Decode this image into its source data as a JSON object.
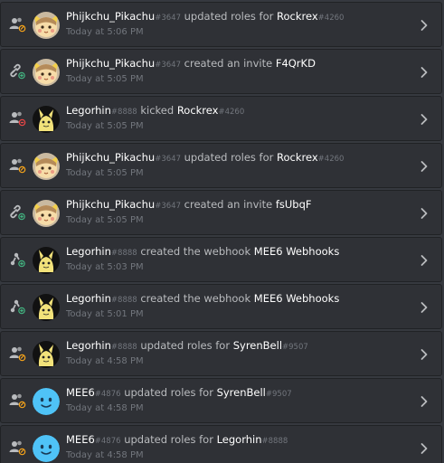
{
  "colors": {
    "background": "#36393f",
    "entry_bg": "#2f3136",
    "accent_update": "#faa61a",
    "accent_create": "#43b581",
    "accent_delete": "#f04747"
  },
  "entries": [
    {
      "action": "update",
      "avatar": "pikachu",
      "user": "Phijkchu_Pikachu",
      "user_disc": "#3647",
      "verb": "updated roles for",
      "target": "Rockrex",
      "target_disc": "#4260",
      "time": "Today at 5:06 PM"
    },
    {
      "action": "invite",
      "avatar": "pikachu",
      "user": "Phijkchu_Pikachu",
      "user_disc": "#3647",
      "verb": "created an invite",
      "target": "F4QrKD",
      "target_disc": "",
      "time": "Today at 5:05 PM"
    },
    {
      "action": "kick",
      "avatar": "mimikyu",
      "user": "Legorhin",
      "user_disc": "#8888",
      "verb": "kicked",
      "target": "Rockrex",
      "target_disc": "#4260",
      "time": "Today at 5:05 PM"
    },
    {
      "action": "update",
      "avatar": "pikachu",
      "user": "Phijkchu_Pikachu",
      "user_disc": "#3647",
      "verb": "updated roles for",
      "target": "Rockrex",
      "target_disc": "#4260",
      "time": "Today at 5:05 PM"
    },
    {
      "action": "invite",
      "avatar": "pikachu",
      "user": "Phijkchu_Pikachu",
      "user_disc": "#3647",
      "verb": "created an invite",
      "target": "fsUbqF",
      "target_disc": "",
      "time": "Today at 5:05 PM"
    },
    {
      "action": "webhook",
      "avatar": "mimikyu",
      "user": "Legorhin",
      "user_disc": "#8888",
      "verb": "created the webhook",
      "target": "MEE6 Webhooks",
      "target_disc": "",
      "time": "Today at 5:03 PM"
    },
    {
      "action": "webhook",
      "avatar": "mimikyu",
      "user": "Legorhin",
      "user_disc": "#8888",
      "verb": "created the webhook",
      "target": "MEE6 Webhooks",
      "target_disc": "",
      "time": "Today at 5:01 PM"
    },
    {
      "action": "update",
      "avatar": "mimikyu",
      "user": "Legorhin",
      "user_disc": "#8888",
      "verb": "updated roles for",
      "target": "SyrenBell",
      "target_disc": "#9507",
      "time": "Today at 4:58 PM"
    },
    {
      "action": "update",
      "avatar": "mee6",
      "user": "MEE6",
      "user_disc": "#4876",
      "verb": "updated roles for",
      "target": "SyrenBell",
      "target_disc": "#9507",
      "time": "Today at 4:58 PM"
    },
    {
      "action": "update",
      "avatar": "mee6",
      "user": "MEE6",
      "user_disc": "#4876",
      "verb": "updated roles for",
      "target": "Legorhin",
      "target_disc": "#8888",
      "time": "Today at 4:58 PM"
    }
  ]
}
